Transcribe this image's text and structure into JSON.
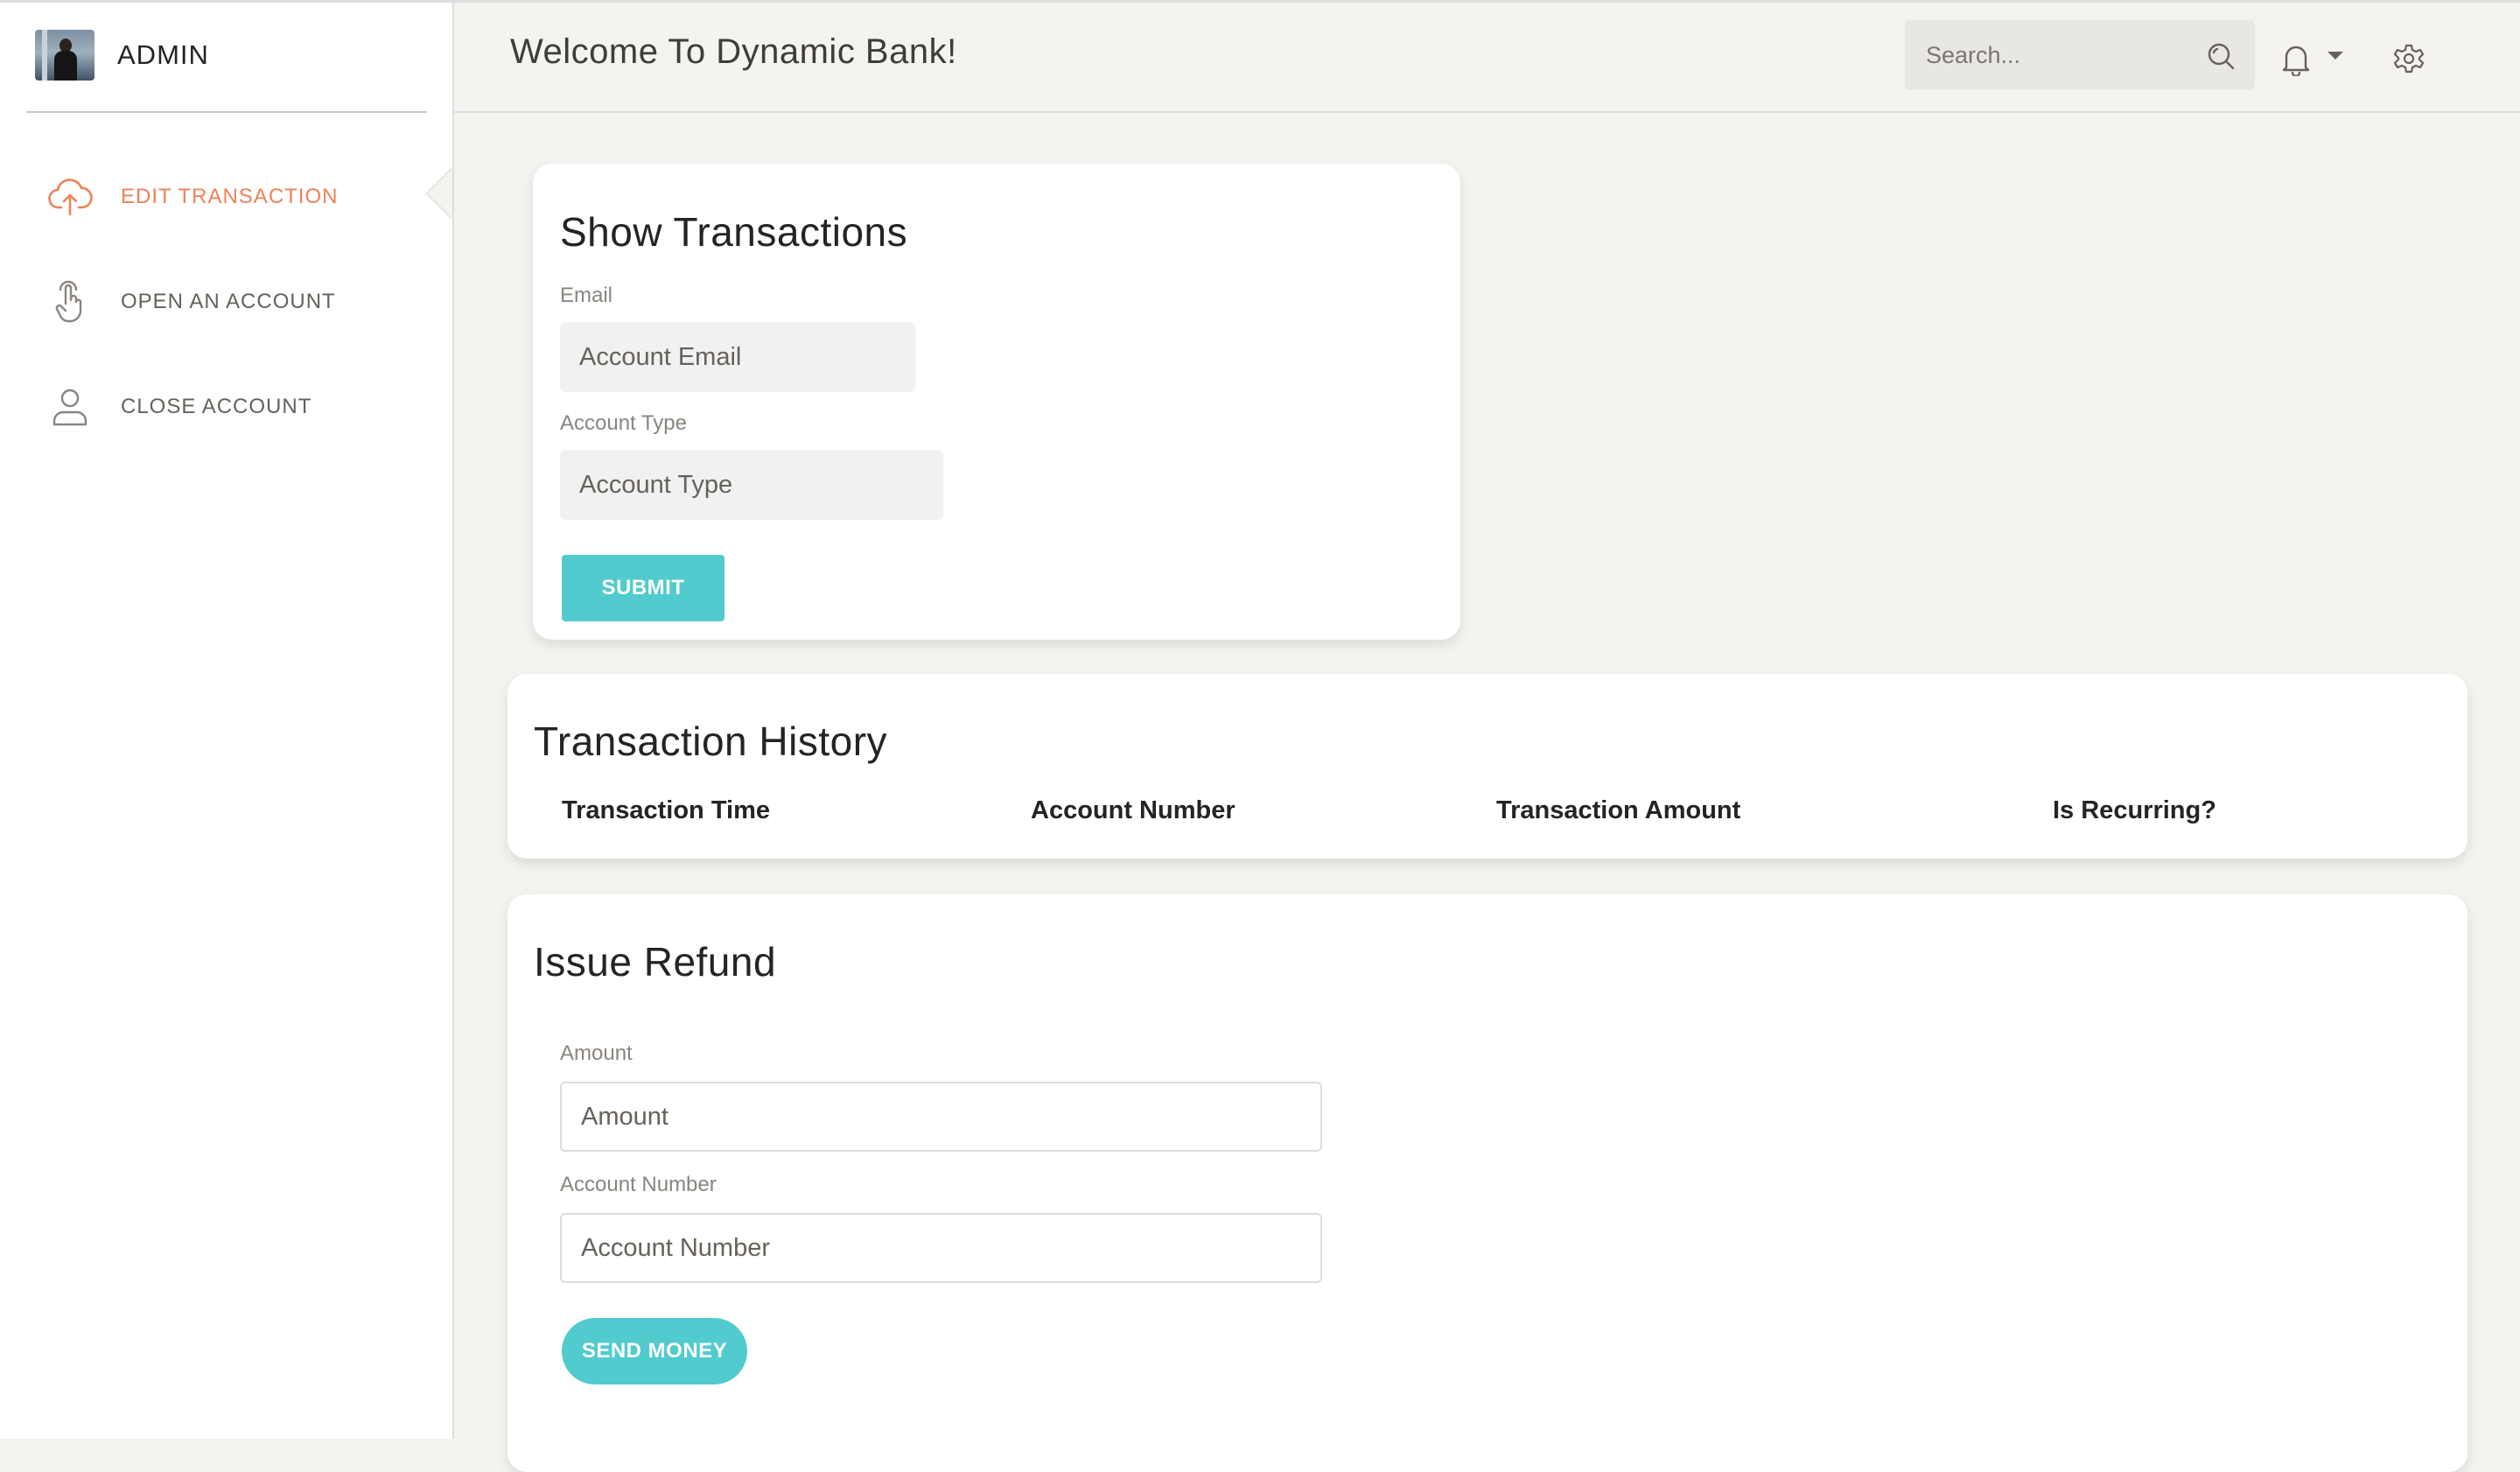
{
  "sidebar": {
    "brand_name": "ADMIN",
    "items": [
      {
        "label": "EDIT TRANSACTION",
        "icon": "cloud-upload-icon",
        "active": true
      },
      {
        "label": "OPEN AN ACCOUNT",
        "icon": "tap-hand-icon",
        "active": false
      },
      {
        "label": "CLOSE ACCOUNT",
        "icon": "user-icon",
        "active": false
      }
    ]
  },
  "header": {
    "title": "Welcome To Dynamic Bank!",
    "search_placeholder": "Search...",
    "icons": [
      "search-icon",
      "bell-icon",
      "caret-down-icon",
      "gear-icon"
    ]
  },
  "show_transactions": {
    "title": "Show Transactions",
    "email_label": "Email",
    "email_placeholder": "Account Email",
    "type_label": "Account Type",
    "type_placeholder": "Account Type",
    "submit_label": "SUBMIT"
  },
  "transaction_history": {
    "title": "Transaction History",
    "columns": [
      "Transaction Time",
      "Account Number",
      "Transaction Amount",
      "Is Recurring?"
    ]
  },
  "issue_refund": {
    "title": "Issue Refund",
    "amount_label": "Amount",
    "amount_placeholder": "Amount",
    "account_label": "Account Number",
    "account_placeholder": "Account Number",
    "send_label": "SEND MONEY"
  },
  "colors": {
    "accent_orange": "#ef8157",
    "accent_teal": "#51cbce",
    "background": "#f4f3ef"
  }
}
